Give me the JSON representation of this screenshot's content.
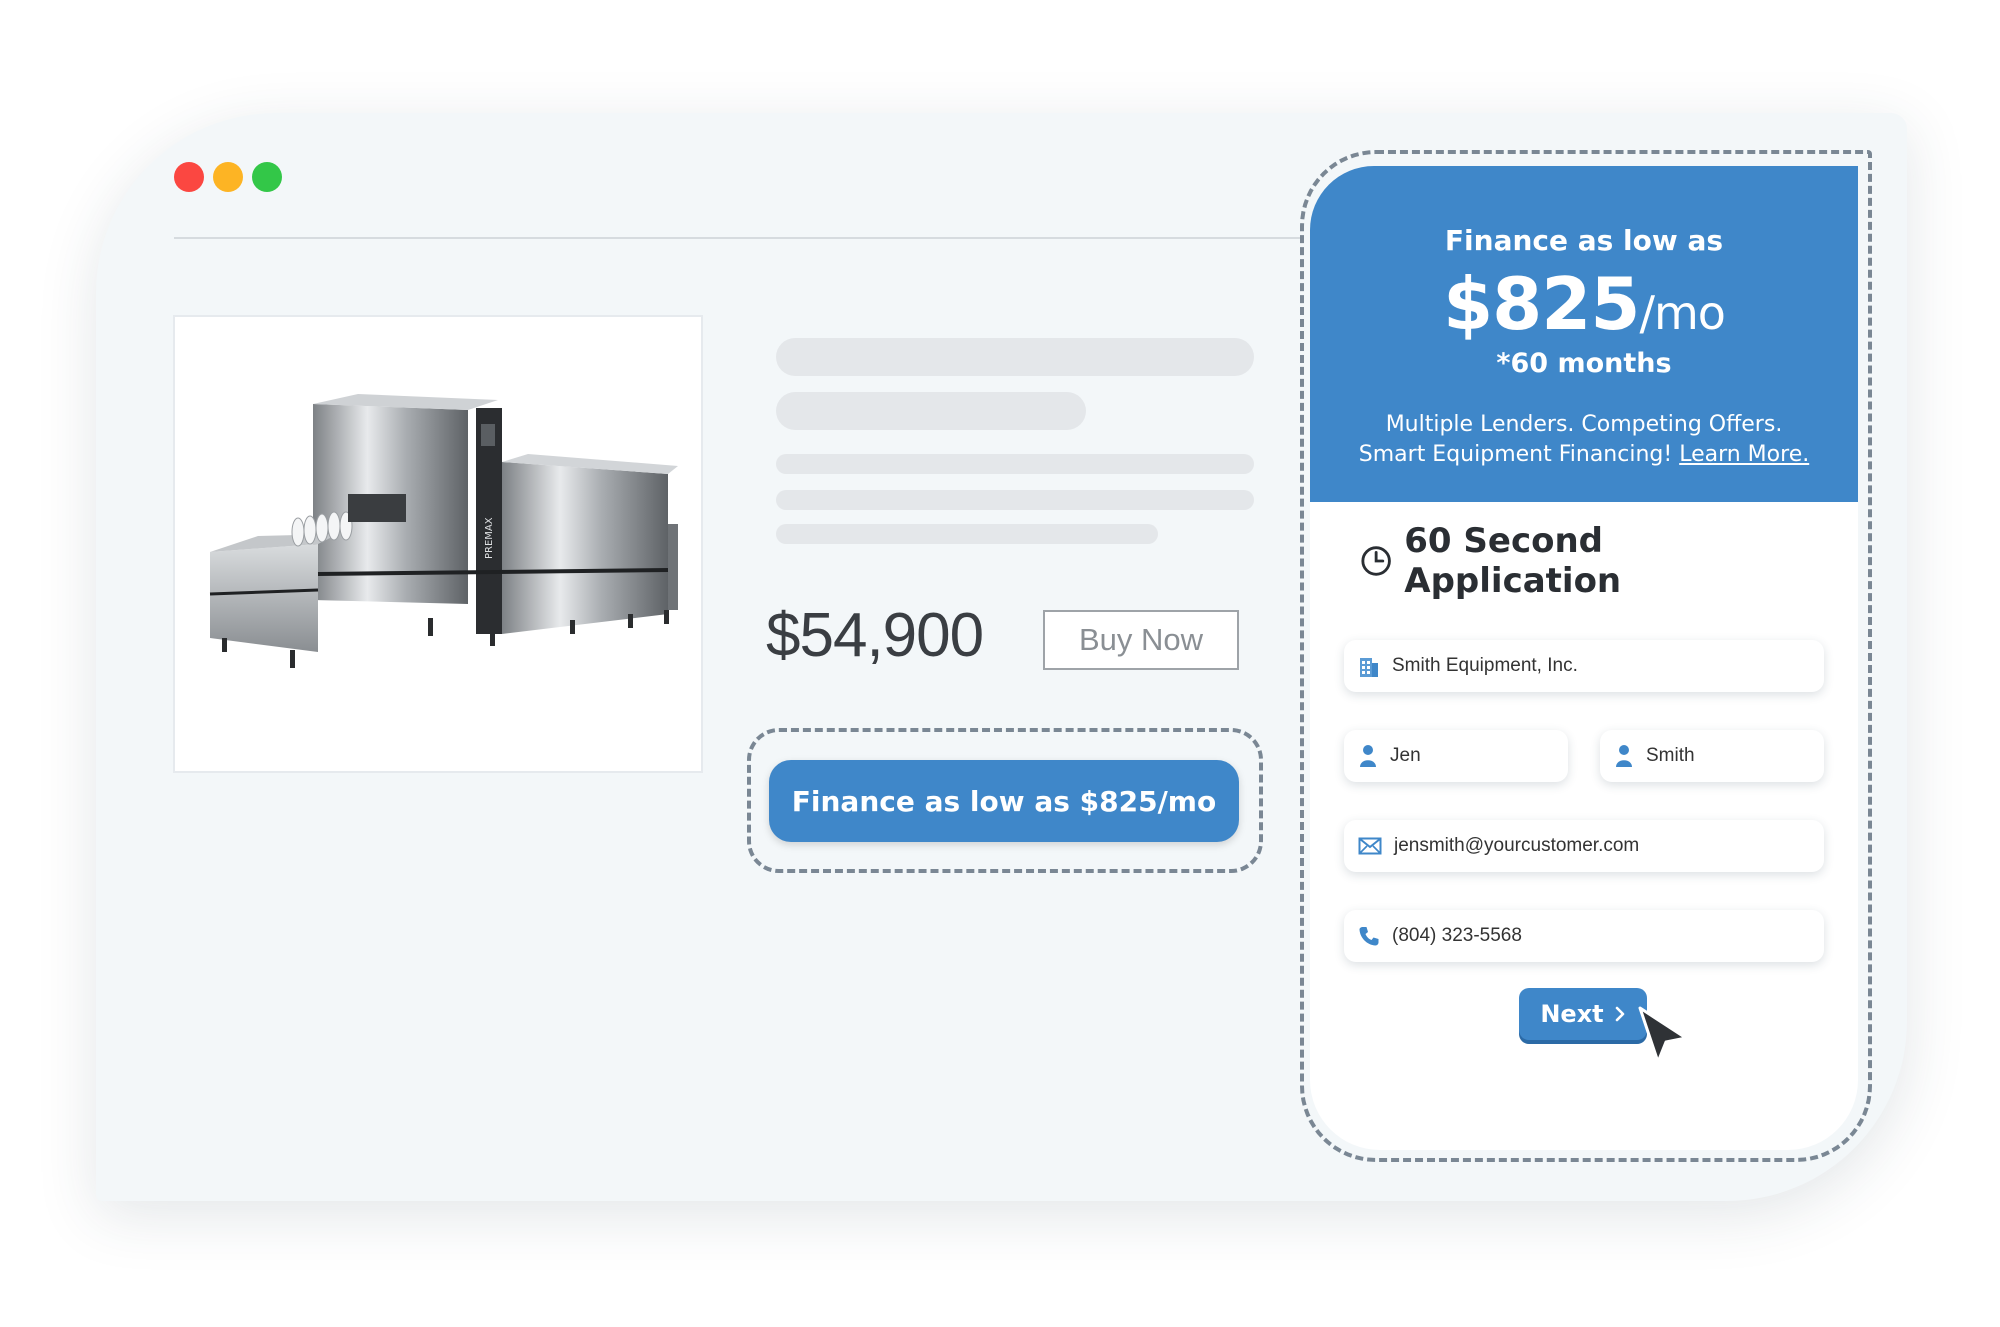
{
  "window": {
    "traffic_lights": [
      "close",
      "minimize",
      "zoom"
    ],
    "colors": {
      "close": "#fb4741",
      "minimize": "#fdb424",
      "zoom": "#33c748"
    }
  },
  "product": {
    "image_label": "PREMAX",
    "price": "$54,900",
    "buy_now_label": "Buy Now",
    "finance_cta_label": "Finance as low as $825/mo"
  },
  "finance_panel": {
    "headline": "Finance as low as",
    "amount": "$825",
    "per": "/mo",
    "term": "*60 months",
    "tagline_1": "Multiple Lenders. Competing Offers.",
    "tagline_2": "Smart Equipment Financing!",
    "learn_more": "Learn More.",
    "accent_color": "#3f87c9"
  },
  "application": {
    "title": "60 Second Application",
    "fields": {
      "company": {
        "value": "Smith Equipment, Inc.",
        "icon": "building-icon"
      },
      "first_name": {
        "value": "Jen",
        "icon": "person-icon"
      },
      "last_name": {
        "value": "Smith",
        "icon": "person-icon"
      },
      "email": {
        "value": "jensmith@yourcustomer.com",
        "icon": "envelope-icon"
      },
      "phone": {
        "value": "(804) 323-5568",
        "icon": "phone-icon"
      }
    },
    "next_label": "Next"
  }
}
